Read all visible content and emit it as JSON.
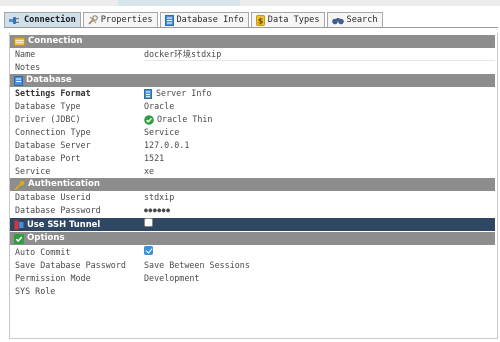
{
  "tabs": [
    {
      "label": "Connection",
      "icon": "plug-icon",
      "active": true
    },
    {
      "label": "Properties",
      "icon": "wrench-icon",
      "active": false
    },
    {
      "label": "Database Info",
      "icon": "database-info-icon",
      "active": false
    },
    {
      "label": "Data Types",
      "icon": "data-types-icon",
      "active": false
    },
    {
      "label": "Search",
      "icon": "binoculars-icon",
      "active": false
    }
  ],
  "sections": {
    "connection": {
      "title": "Connection",
      "icon": "folder-icon"
    },
    "database": {
      "title": "Database",
      "icon": "database-icon"
    },
    "authentication": {
      "title": "Authentication",
      "icon": "key-icon"
    },
    "options": {
      "title": "Options",
      "icon": "check-icon"
    }
  },
  "fields": {
    "name": {
      "label": "Name",
      "value": "docker环境stdxip"
    },
    "notes": {
      "label": "Notes",
      "value": ""
    },
    "settings_format": {
      "label": "Settings Format",
      "value": "Server Info"
    },
    "database_type": {
      "label": "Database Type",
      "value": "Oracle"
    },
    "driver": {
      "label": "Driver (JDBC)",
      "value": "Oracle Thin"
    },
    "connection_type": {
      "label": "Connection Type",
      "value": "Service"
    },
    "database_server": {
      "label": "Database Server",
      "value": "127.0.0.1"
    },
    "database_port": {
      "label": "Database Port",
      "value": "1521"
    },
    "service": {
      "label": "Service",
      "value": "xe"
    },
    "database_userid": {
      "label": "Database Userid",
      "value": "stdxip"
    },
    "database_password": {
      "label": "Database Password",
      "value": "●●●●●●"
    },
    "use_ssh_tunnel": {
      "label": "Use SSH Tunnel",
      "checked": false
    },
    "auto_commit": {
      "label": "Auto Commit",
      "checked": true
    },
    "save_database_password": {
      "label": "Save Database Password",
      "value": "Save Between Sessions"
    },
    "permission_mode": {
      "label": "Permission Mode",
      "value": "Development"
    },
    "sys_role": {
      "label": "SYS Role",
      "value": ""
    }
  },
  "colors": {
    "section_header": "#8d8d8d",
    "selected_row": "#2f4763",
    "active_tab": "#cfe0ea",
    "checkbox_on": "#3a8fe0"
  }
}
